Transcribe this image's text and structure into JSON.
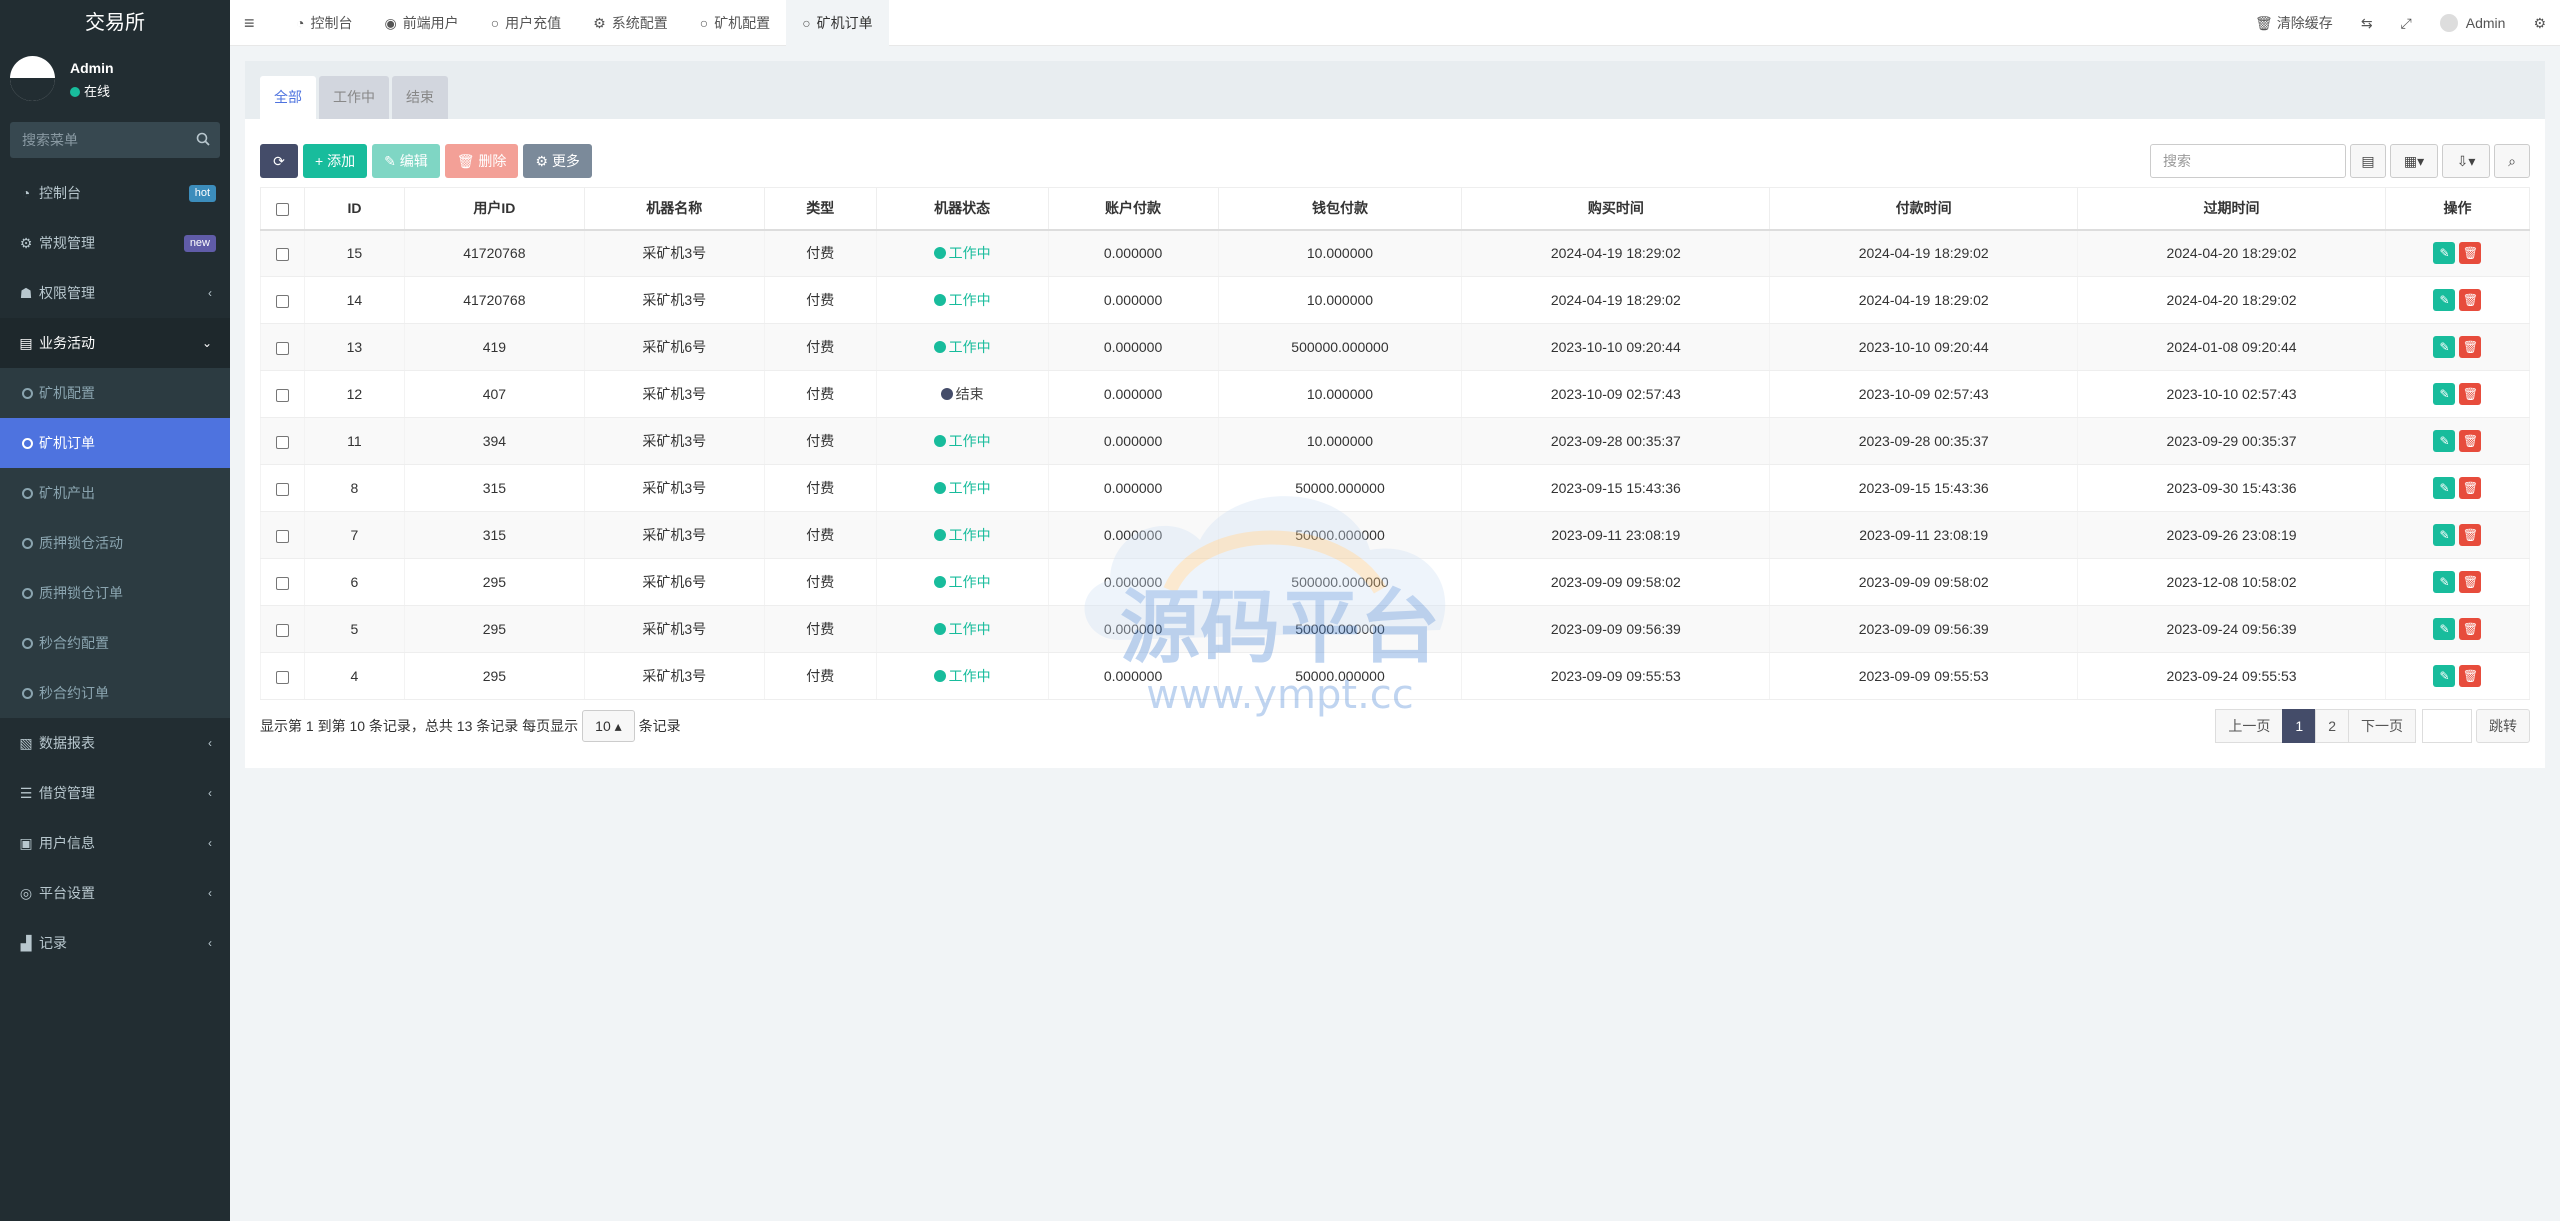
{
  "sidebar": {
    "logo": "交易所",
    "user": {
      "name": "Admin",
      "status": "在线"
    },
    "search_placeholder": "搜索菜单",
    "menu": [
      {
        "label": "控制台",
        "icon": "dashboard-icon",
        "badge": "hot",
        "badge_color": "#3c8dbc"
      },
      {
        "label": "常规管理",
        "icon": "cogs-icon",
        "badge": "new",
        "badge_color": "#605ca8"
      },
      {
        "label": "权限管理",
        "icon": "group-icon",
        "arrow": "‹"
      },
      {
        "label": "业务活动",
        "icon": "business-icon",
        "arrow": "⌄"
      }
    ],
    "submenu": [
      {
        "label": "矿机配置"
      },
      {
        "label": "矿机订单",
        "active": true
      },
      {
        "label": "矿机产出"
      },
      {
        "label": "质押锁仓活动"
      },
      {
        "label": "质押锁仓订单"
      },
      {
        "label": "秒合约配置"
      },
      {
        "label": "秒合约订单"
      }
    ],
    "menu2": [
      {
        "label": "数据报表",
        "icon": "file-icon"
      },
      {
        "label": "借贷管理",
        "icon": "list-icon"
      },
      {
        "label": "用户信息",
        "icon": "user-card-icon"
      },
      {
        "label": "平台设置",
        "icon": "settings-icon"
      },
      {
        "label": "记录",
        "icon": "chart-icon"
      }
    ]
  },
  "topnav": {
    "tabs": [
      {
        "label": "控制台",
        "icon": "dashboard-icon"
      },
      {
        "label": "前端用户",
        "icon": "user-circle-icon"
      },
      {
        "label": "用户充值",
        "icon": "circle-icon"
      },
      {
        "label": "系统配置",
        "icon": "gear-icon"
      },
      {
        "label": "矿机配置",
        "icon": "circle-icon"
      },
      {
        "label": "矿机订单",
        "icon": "circle-icon",
        "active": true
      }
    ],
    "clear_cache": "清除缓存",
    "admin": "Admin"
  },
  "content": {
    "tabs": [
      "全部",
      "工作中",
      "结束"
    ],
    "toolbar": {
      "add": "添加",
      "edit": "编辑",
      "delete": "删除",
      "more": "更多"
    },
    "search_placeholder": "搜索",
    "columns": [
      "ID",
      "用户ID",
      "机器名称",
      "类型",
      "机器状态",
      "账户付款",
      "钱包付款",
      "购买时间",
      "付款时间",
      "过期时间",
      "操作"
    ],
    "rows": [
      {
        "id": "15",
        "uid": "41720768",
        "name": "采矿机3号",
        "type": "付费",
        "status": "工作中",
        "state": "work",
        "acct": "0.000000",
        "wallet": "10.000000",
        "buy": "2024-04-19 18:29:02",
        "pay": "2024-04-19 18:29:02",
        "expire": "2024-04-20 18:29:02"
      },
      {
        "id": "14",
        "uid": "41720768",
        "name": "采矿机3号",
        "type": "付费",
        "status": "工作中",
        "state": "work",
        "acct": "0.000000",
        "wallet": "10.000000",
        "buy": "2024-04-19 18:29:02",
        "pay": "2024-04-19 18:29:02",
        "expire": "2024-04-20 18:29:02"
      },
      {
        "id": "13",
        "uid": "419",
        "name": "采矿机6号",
        "type": "付费",
        "status": "工作中",
        "state": "work",
        "acct": "0.000000",
        "wallet": "500000.000000",
        "buy": "2023-10-10 09:20:44",
        "pay": "2023-10-10 09:20:44",
        "expire": "2024-01-08 09:20:44"
      },
      {
        "id": "12",
        "uid": "407",
        "name": "采矿机3号",
        "type": "付费",
        "status": "结束",
        "state": "end",
        "acct": "0.000000",
        "wallet": "10.000000",
        "buy": "2023-10-09 02:57:43",
        "pay": "2023-10-09 02:57:43",
        "expire": "2023-10-10 02:57:43"
      },
      {
        "id": "11",
        "uid": "394",
        "name": "采矿机3号",
        "type": "付费",
        "status": "工作中",
        "state": "work",
        "acct": "0.000000",
        "wallet": "10.000000",
        "buy": "2023-09-28 00:35:37",
        "pay": "2023-09-28 00:35:37",
        "expire": "2023-09-29 00:35:37"
      },
      {
        "id": "8",
        "uid": "315",
        "name": "采矿机3号",
        "type": "付费",
        "status": "工作中",
        "state": "work",
        "acct": "0.000000",
        "wallet": "50000.000000",
        "buy": "2023-09-15 15:43:36",
        "pay": "2023-09-15 15:43:36",
        "expire": "2023-09-30 15:43:36"
      },
      {
        "id": "7",
        "uid": "315",
        "name": "采矿机3号",
        "type": "付费",
        "status": "工作中",
        "state": "work",
        "acct": "0.000000",
        "wallet": "50000.000000",
        "buy": "2023-09-11 23:08:19",
        "pay": "2023-09-11 23:08:19",
        "expire": "2023-09-26 23:08:19"
      },
      {
        "id": "6",
        "uid": "295",
        "name": "采矿机6号",
        "type": "付费",
        "status": "工作中",
        "state": "work",
        "acct": "0.000000",
        "wallet": "500000.000000",
        "buy": "2023-09-09 09:58:02",
        "pay": "2023-09-09 09:58:02",
        "expire": "2023-12-08 10:58:02"
      },
      {
        "id": "5",
        "uid": "295",
        "name": "采矿机3号",
        "type": "付费",
        "status": "工作中",
        "state": "work",
        "acct": "0.000000",
        "wallet": "50000.000000",
        "buy": "2023-09-09 09:56:39",
        "pay": "2023-09-09 09:56:39",
        "expire": "2023-09-24 09:56:39"
      },
      {
        "id": "4",
        "uid": "295",
        "name": "采矿机3号",
        "type": "付费",
        "status": "工作中",
        "state": "work",
        "acct": "0.000000",
        "wallet": "50000.000000",
        "buy": "2023-09-09 09:55:53",
        "pay": "2023-09-09 09:55:53",
        "expire": "2023-09-24 09:55:53"
      }
    ],
    "footer": {
      "summary": "显示第 1 到第 10 条记录，总共 13 条记录 每页显示",
      "page_size": "10",
      "suffix": "条记录"
    },
    "pager": {
      "prev": "上一页",
      "pages": [
        "1",
        "2"
      ],
      "next": "下一页",
      "jump": "跳转"
    }
  },
  "watermark": {
    "title": "源码平台",
    "url": "www.ympt.cc"
  },
  "colors": {
    "accent": "#4e73df",
    "success": "#18bc9c",
    "danger": "#e74c3c",
    "sidebar": "#222d32"
  }
}
